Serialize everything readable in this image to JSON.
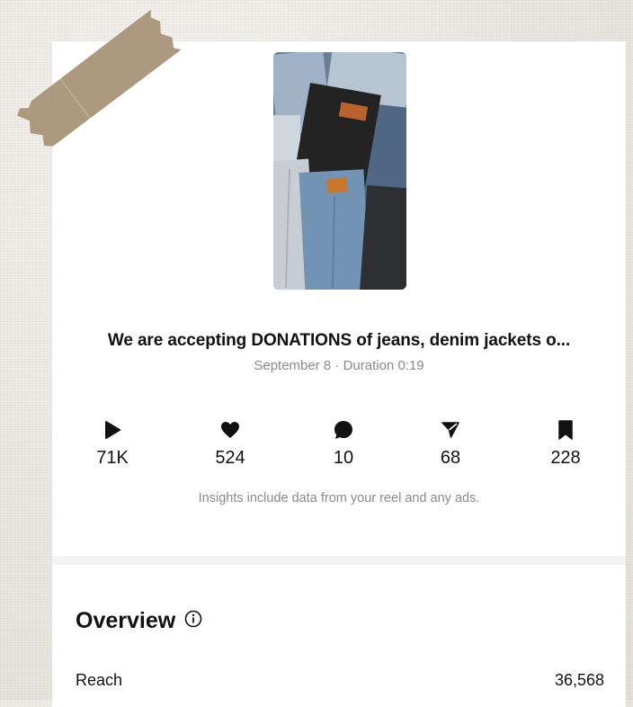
{
  "reel": {
    "caption": "We are accepting DONATIONS of jeans, denim jackets o...",
    "meta": "September 8 · Duration 0:19",
    "thumbnail_icon": "denim-stack-thumbnail"
  },
  "stats": [
    {
      "icon": "play-icon",
      "value": "71K"
    },
    {
      "icon": "heart-icon",
      "value": "524"
    },
    {
      "icon": "comment-icon",
      "value": "10"
    },
    {
      "icon": "share-icon",
      "value": "68"
    },
    {
      "icon": "bookmark-icon",
      "value": "228"
    }
  ],
  "note": "Insights include data from your reel and any ads.",
  "overview": {
    "title": "Overview",
    "rows": [
      {
        "label": "Reach",
        "value": "36,568"
      }
    ]
  }
}
